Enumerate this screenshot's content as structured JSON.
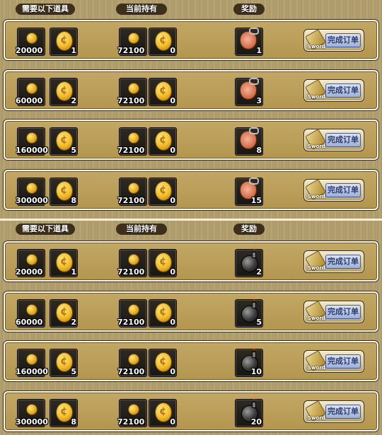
{
  "headers": {
    "required": "需要以下道具",
    "held": "当前持有",
    "reward": "奖励"
  },
  "button": {
    "label": "完成订单",
    "icon_text": "Sword"
  },
  "panels": [
    {
      "rows": [
        {
          "req_coin": "20000",
          "req_gold": "1",
          "held_coin": "72100",
          "held_gold": "0",
          "reward_item": "pouch-icon",
          "reward_count": "1"
        },
        {
          "req_coin": "60000",
          "req_gold": "2",
          "held_coin": "72100",
          "held_gold": "0",
          "reward_item": "pouch-icon",
          "reward_count": "3"
        },
        {
          "req_coin": "160000",
          "req_gold": "5",
          "held_coin": "72100",
          "held_gold": "0",
          "reward_item": "pouch-icon",
          "reward_count": "8"
        },
        {
          "req_coin": "300000",
          "req_gold": "8",
          "held_coin": "72100",
          "held_gold": "0",
          "reward_item": "pouch-icon",
          "reward_count": "15"
        }
      ]
    },
    {
      "rows": [
        {
          "req_coin": "20000",
          "req_gold": "1",
          "held_coin": "72100",
          "held_gold": "0",
          "reward_item": "bomb-icon",
          "reward_count": "2"
        },
        {
          "req_coin": "60000",
          "req_gold": "2",
          "held_coin": "72100",
          "held_gold": "0",
          "reward_item": "bomb-icon",
          "reward_count": "5"
        },
        {
          "req_coin": "160000",
          "req_gold": "5",
          "held_coin": "72100",
          "held_gold": "0",
          "reward_item": "bomb-icon",
          "reward_count": "10"
        },
        {
          "req_coin": "300000",
          "req_gold": "8",
          "held_coin": "72100",
          "held_gold": "0",
          "reward_item": "bomb-icon",
          "reward_count": "20"
        }
      ]
    }
  ]
}
